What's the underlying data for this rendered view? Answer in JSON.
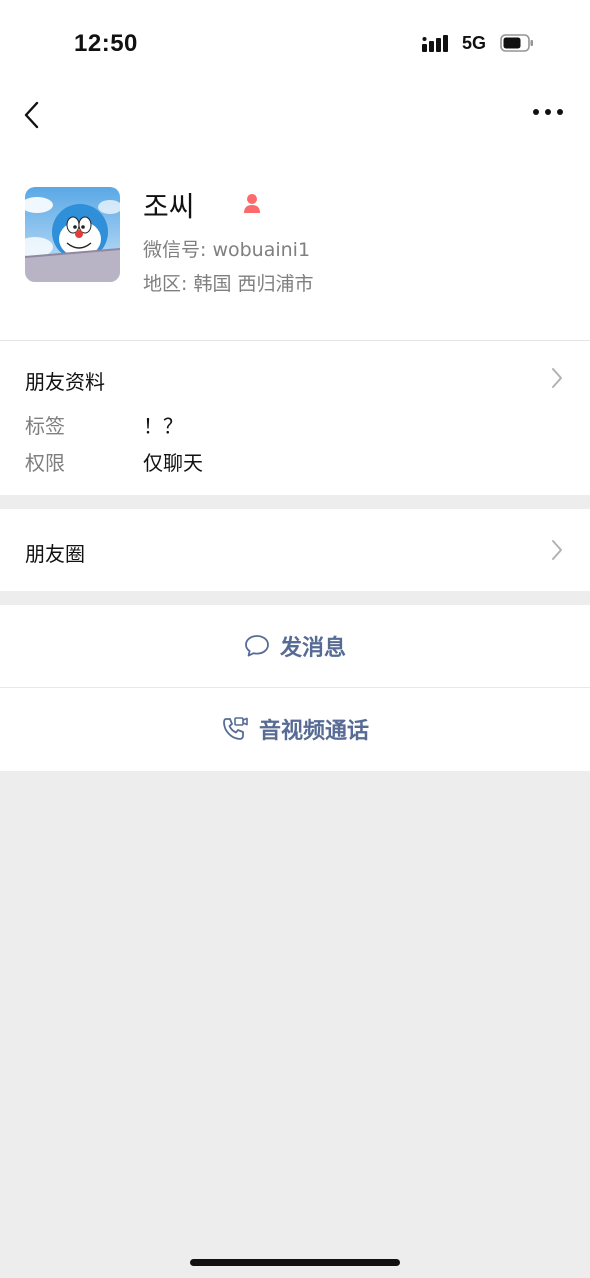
{
  "status_bar": {
    "time": "12:50",
    "network": "5G"
  },
  "nav": {
    "back_icon": "chevron-left-icon",
    "more_icon": "more-dots-icon"
  },
  "profile": {
    "name": "조씨",
    "wechat_id": "微信号: wobuaini1",
    "region": "地区: 韩国 西归浦市",
    "gender_icon": "female-icon",
    "gender_color": "#fa5151"
  },
  "friend_info": {
    "title": "朋友资料",
    "rows": [
      {
        "label": "标签",
        "value": "！？"
      },
      {
        "label": "权限",
        "value": "仅聊天"
      }
    ]
  },
  "moments": {
    "title": "朋友圈"
  },
  "actions": {
    "message_label": "发消息",
    "call_label": "音视频通话",
    "accent_color": "#576b95"
  }
}
